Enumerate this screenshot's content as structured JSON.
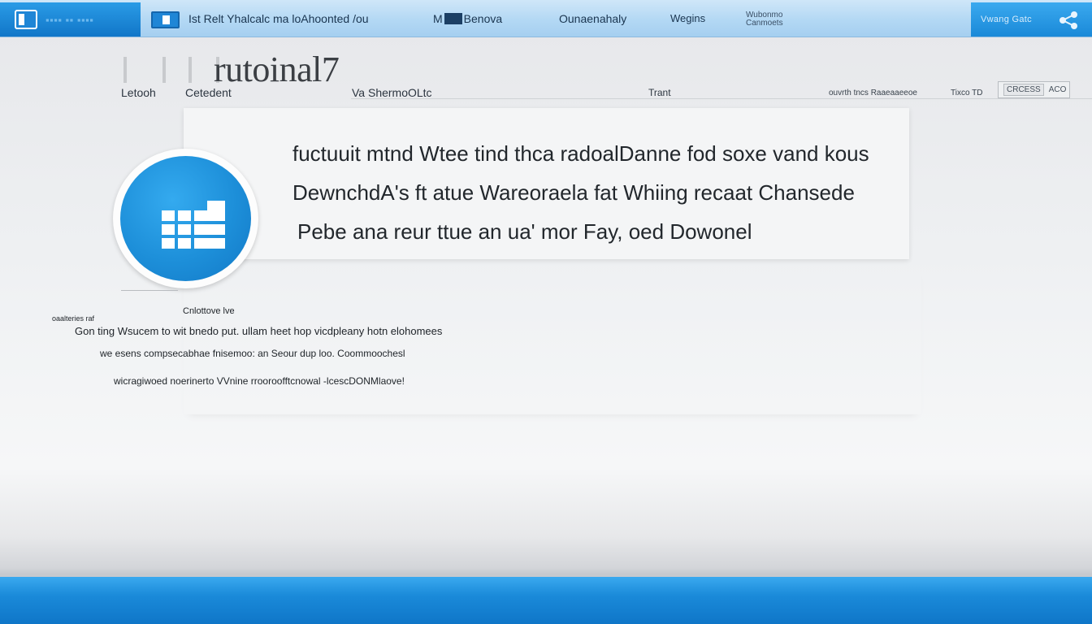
{
  "topbar": {
    "brand_label": "▪▪▪▪ ▪▪ ▪▪▪▪",
    "nav": [
      "Ist Relt  Yhalcalc  ma  loAhoonted  /ou",
      "M",
      "Benova",
      "Ounaenahaly",
      "Wegins",
      "Wubonmo\nCanmoets"
    ],
    "right_label": "Vwang  Gatc",
    "icons": {
      "brand": "app-window-icon",
      "tab": "window-icon",
      "share": "share-icon"
    }
  },
  "heading": {
    "title": "rutoinal7",
    "subnav": [
      "Letooh",
      "Cetedent",
      "Va  ShermoOLtc",
      "Trant",
      "ouvrth  tncs  Raaeaaeeoe",
      "Tixco  TD",
      "Cancess"
    ],
    "filter_options": [
      "CRCESS",
      "ACO"
    ]
  },
  "card": {
    "lines": [
      "fuctuuit  mtnd  Wtee  tind  thca  radoalDanne  fod  soxe  vand  kous",
      "DewnchdA's  ft  atue  Wareoraela  fat Whiing  recaat  Chansede",
      "Pebe  ana  reur  ttue  an  ua' mor  Fay,  oed  Dowonel"
    ],
    "badge_icon": "grid-icon"
  },
  "details": {
    "caption": "Cnlottove  lve",
    "label": "oaalteries  raf",
    "lines": [
      "Gon  ting  Wsucem  to wit  bnedo  put.  ullam  heet  hop  vicdpleany  hotn  elohomees",
      "we  esens  compsecabhae  fnisemoo:  an  Seour  dup  loo.  Coommoochesl",
      "wicragiwoed  noerinerto VVnine  rrooroofftcnowal  -lcescDONMlaove!"
    ]
  },
  "colors": {
    "accent": "#1a8ad9",
    "accent_dark": "#1176c8",
    "topbar": "#b3d8f4"
  }
}
